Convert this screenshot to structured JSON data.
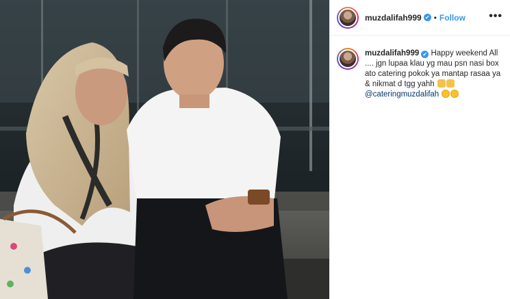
{
  "post": {
    "username": "muzdalifah999",
    "follow_label": "Follow",
    "separator": "•",
    "more_label": "•••",
    "verified_glyph": "✔"
  },
  "caption": {
    "username": "muzdalifah999",
    "text_line1": "Happy weekend All",
    "text_line2": ".... jgn lupaa klau yg mau psn nasi box",
    "text_line3": "ato catering pokok ya mantap rasaa ya",
    "text_line4": "& nikmat d tgg yahh",
    "mention": "@cateringmuzdalifah",
    "emojis_line4": [
      "thumbs-up-icon",
      "thumbs-up-icon"
    ],
    "emojis_line5": [
      "face-icon",
      "face-icon"
    ]
  },
  "colors": {
    "follow": "#3897f0",
    "verified": "#3897f0",
    "mention": "#00376b",
    "text": "#262626"
  }
}
